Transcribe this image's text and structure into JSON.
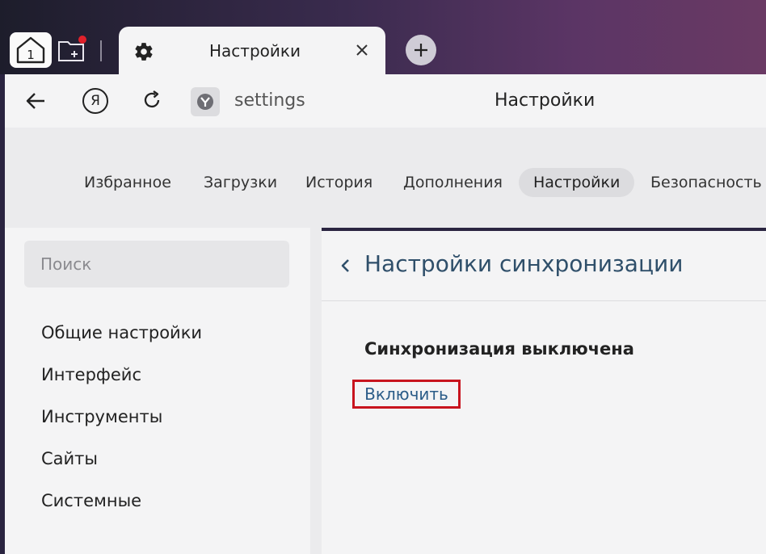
{
  "tab": {
    "title": "Настройки",
    "home_badge": "1"
  },
  "navbar": {
    "ya_glyph": "Я",
    "url": "settings",
    "page_title": "Настройки"
  },
  "topnav": {
    "items": [
      "Избранное",
      "Загрузки",
      "История",
      "Дополнения",
      "Настройки",
      "Безопасность"
    ],
    "active_index": 4
  },
  "sidebar": {
    "search_placeholder": "Поиск",
    "items": [
      "Общие настройки",
      "Интерфейс",
      "Инструменты",
      "Сайты",
      "Системные"
    ]
  },
  "content": {
    "title": "Настройки синхронизации",
    "status": "Синхронизация выключена",
    "enable_link": "Включить"
  },
  "colors": {
    "accent_link": "#2b5c88",
    "highlight_box": "#c8141e",
    "notification_dot": "#e0212b"
  },
  "icons": [
    "home-icon",
    "new-folder-icon",
    "gear-icon",
    "close-icon",
    "plus-icon",
    "back-arrow-icon",
    "yandex-icon",
    "reload-icon",
    "browser-shield-icon",
    "chevron-left-icon"
  ]
}
